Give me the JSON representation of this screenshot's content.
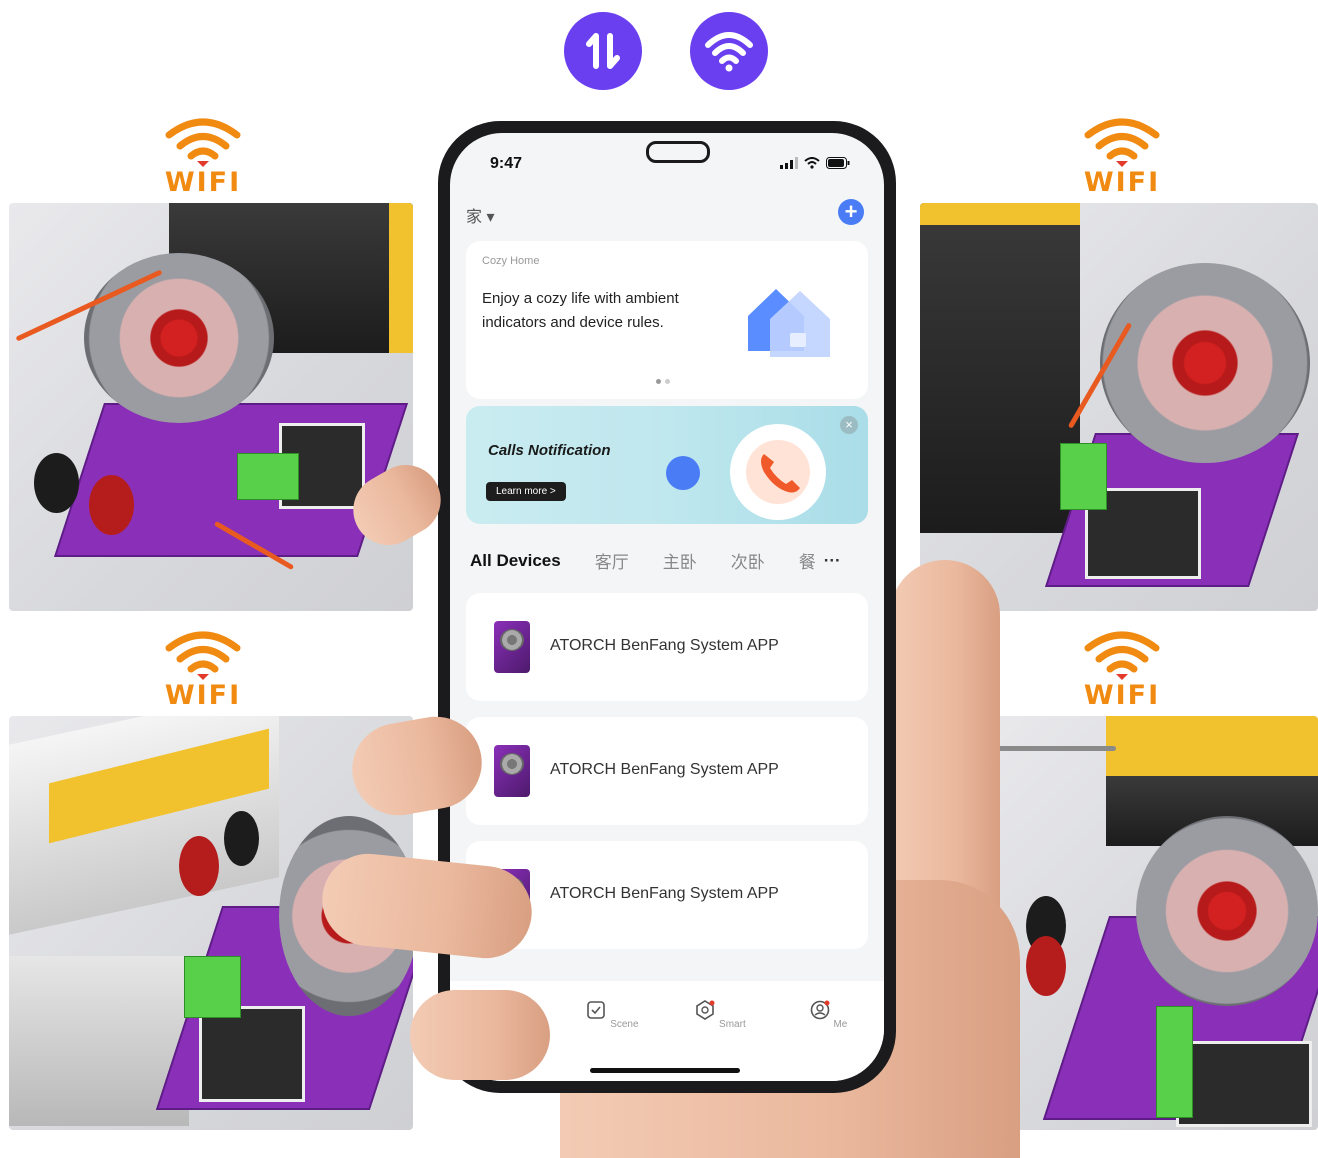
{
  "top_icons": [
    {
      "icon": "data-transfer-icon",
      "color": "#6a3ff0"
    },
    {
      "icon": "wifi-icon",
      "color": "#6a3ff0"
    }
  ],
  "wifi_label": "WIFI",
  "wifi_color": "#f08a10",
  "phone": {
    "status": {
      "time": "9:47"
    },
    "home_selector": "家 ▾",
    "add_symbol": "+",
    "banner": {
      "label": "Cozy Home",
      "text": "Enjoy a cozy life with ambient indicators and device rules."
    },
    "calls": {
      "title": "Calls Notification",
      "learn_more": "Learn more >",
      "close": "×"
    },
    "tabs": [
      "All Devices",
      "客厅",
      "主卧",
      "次卧",
      "餐"
    ],
    "tabs_more": "···",
    "devices": [
      {
        "name": "ATORCH BenFang System APP"
      },
      {
        "name": "ATORCH BenFang System APP"
      },
      {
        "name": "ATORCH BenFang System APP"
      }
    ],
    "nav": [
      {
        "label": "",
        "icon": "home-icon",
        "active": true
      },
      {
        "label": "Scene",
        "icon": "scene-icon"
      },
      {
        "label": "Smart",
        "icon": "smart-icon"
      },
      {
        "label": "Me",
        "icon": "profile-icon"
      }
    ],
    "accent": "#4a7cf6"
  }
}
